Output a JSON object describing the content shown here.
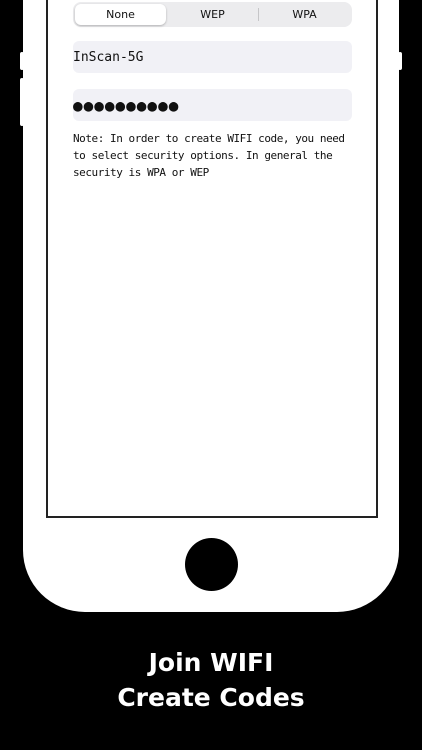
{
  "security_selector": {
    "options": [
      "None",
      "WEP",
      "WPA"
    ],
    "selected": "None"
  },
  "ssid_field": {
    "value": "InScan-5G"
  },
  "password_field": {
    "value": "●●●●●●●●●●"
  },
  "note": {
    "text": "Note: In order to create WIFI code, you need to select security options. In general the security is WPA or WEP"
  },
  "caption": {
    "line1": "Join WIFI",
    "line2": "Create Codes"
  },
  "colors": {
    "background": "#000000",
    "phone": "#ffffff",
    "field_background": "#f1f1f6",
    "segment_background": "#ececee"
  }
}
